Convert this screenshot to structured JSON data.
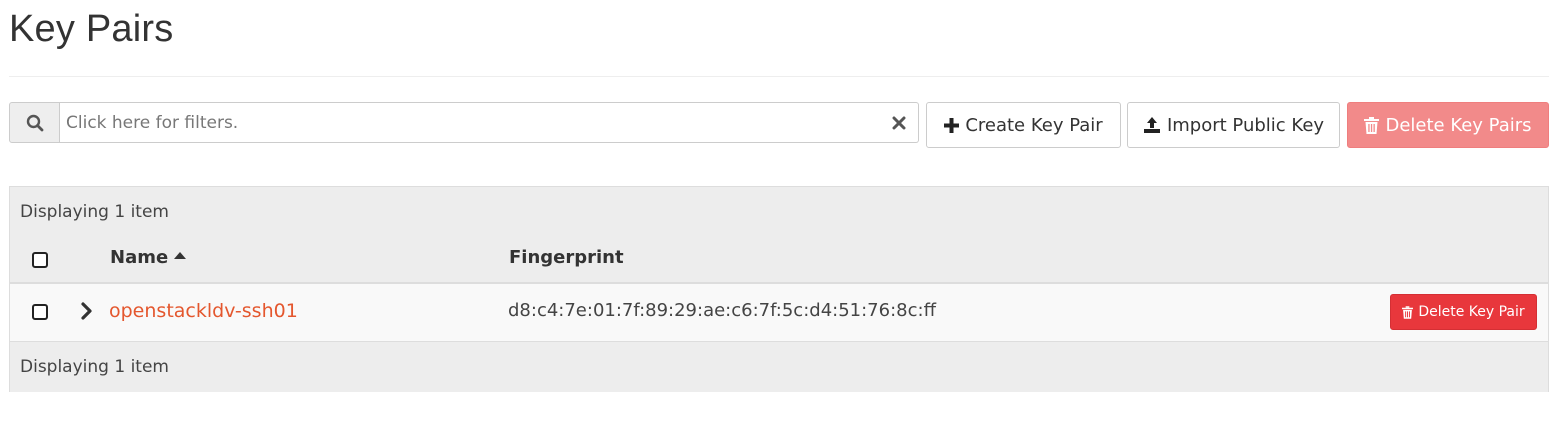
{
  "page": {
    "title": "Key Pairs"
  },
  "filter": {
    "placeholder": "Click here for filters.",
    "value": ""
  },
  "actions": {
    "create_label": "Create Key Pair",
    "import_label": "Import Public Key",
    "delete_all_label": "Delete Key Pairs"
  },
  "table": {
    "count_text": "Displaying 1 item",
    "columns": {
      "name": "Name",
      "fingerprint": "Fingerprint"
    },
    "sort": {
      "column": "Name",
      "direction": "ascending"
    },
    "rows": [
      {
        "name": "openstackldv-ssh01",
        "fingerprint": "d8:c4:7e:01:7f:89:29:ae:c6:7f:5c:d4:51:76:8c:ff",
        "delete_label": "Delete Key Pair"
      }
    ]
  },
  "colors": {
    "link": "#e4572e",
    "danger": "#e8373c",
    "danger_disabled": "#f28a8a"
  },
  "icons": [
    "search-icon",
    "clear-icon",
    "plus-icon",
    "upload-icon",
    "trash-icon",
    "sort-up-icon",
    "chevron-right-icon"
  ]
}
